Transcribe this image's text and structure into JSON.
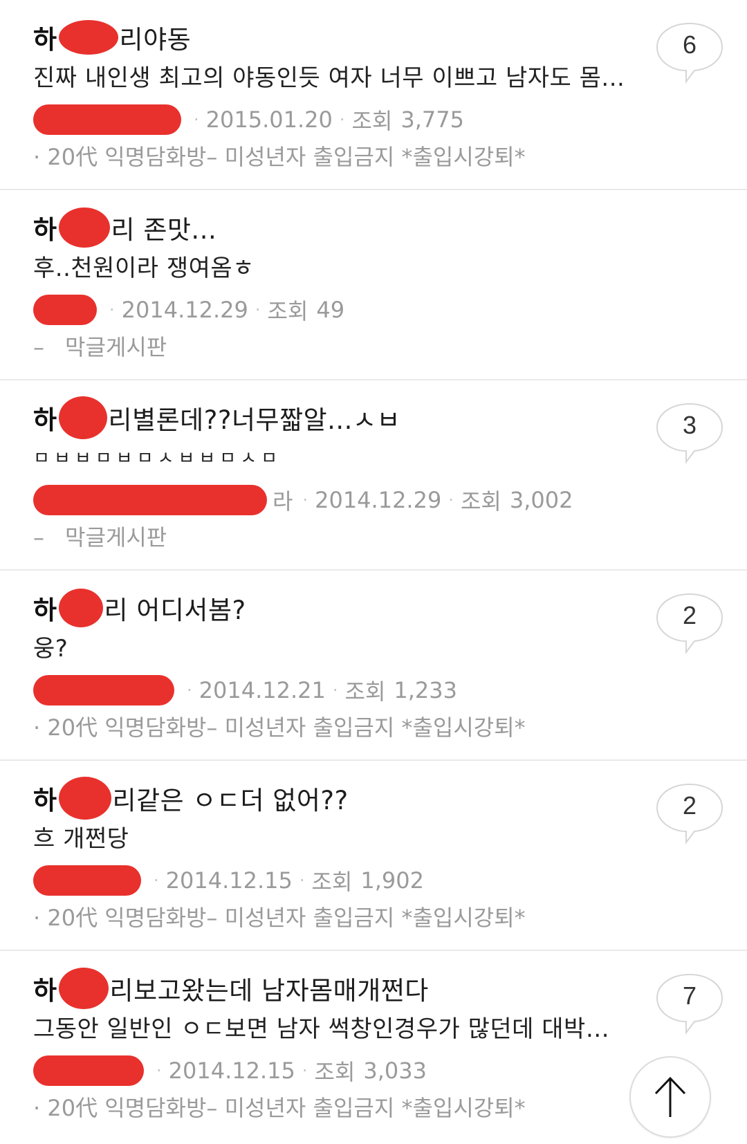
{
  "posts": [
    {
      "title_prefix": "하",
      "title_suffix": "리야동",
      "preview": "진짜 내인생 최고의 야동인듯 여자 너무 이쁘고 남자도 몸...",
      "author_tail": "",
      "date": "2015.01.20",
      "views_label": "조회",
      "views": "3,775",
      "board": "· 20代 익명담화방– 미성년자 출입금지 *출입시강퇴*",
      "board_dash": "",
      "comments": "6"
    },
    {
      "title_prefix": "하",
      "title_suffix": "리 존맛...",
      "preview": "후..천원이라 쟁여옴ㅎ",
      "author_tail": "",
      "date": "2014.12.29",
      "views_label": "조회",
      "views": "49",
      "board": "막글게시판",
      "board_dash": "–",
      "comments": ""
    },
    {
      "title_prefix": "하",
      "title_suffix": "리별론데??너무짧알...ㅅㅂ",
      "preview": "ㅁㅂㅂㅁㅂㅁㅅㅂㅂㅁㅅㅁ",
      "author_tail": "라",
      "date": "2014.12.29",
      "views_label": "조회",
      "views": "3,002",
      "board": "막글게시판",
      "board_dash": "–",
      "comments": "3"
    },
    {
      "title_prefix": "하",
      "title_suffix": "리 어디서봄?",
      "preview": "웅?",
      "author_tail": "",
      "date": "2014.12.21",
      "views_label": "조회",
      "views": "1,233",
      "board": "· 20代 익명담화방– 미성년자 출입금지 *출입시강퇴*",
      "board_dash": "",
      "comments": "2"
    },
    {
      "title_prefix": "하",
      "title_suffix": "리같은 ㅇㄷ더 없어??",
      "preview": "흐 개쩐당",
      "author_tail": "",
      "date": "2014.12.15",
      "views_label": "조회",
      "views": "1,902",
      "board": "· 20代 익명담화방– 미성년자 출입금지 *출입시강퇴*",
      "board_dash": "",
      "comments": "2"
    },
    {
      "title_prefix": "하",
      "title_suffix": "리보고왔는데 남자몸매개쩐다",
      "preview": "그동안 일반인 ㅇㄷ보면 남자 썩창인경우가 많던데 대박이...",
      "author_tail": "",
      "date": "2014.12.15",
      "views_label": "조회",
      "views": "3,033",
      "board": "· 20代 익명담화방– 미성년자 출입금지 *출입시강퇴*",
      "board_dash": "",
      "comments": "7"
    }
  ],
  "colors": {
    "redaction": "#e8312d",
    "meta_text": "#9a9a9a",
    "divider": "#e9e9e9"
  },
  "icons": {
    "comment": "speech-bubble-icon",
    "scroll_top": "arrow-up-icon"
  }
}
